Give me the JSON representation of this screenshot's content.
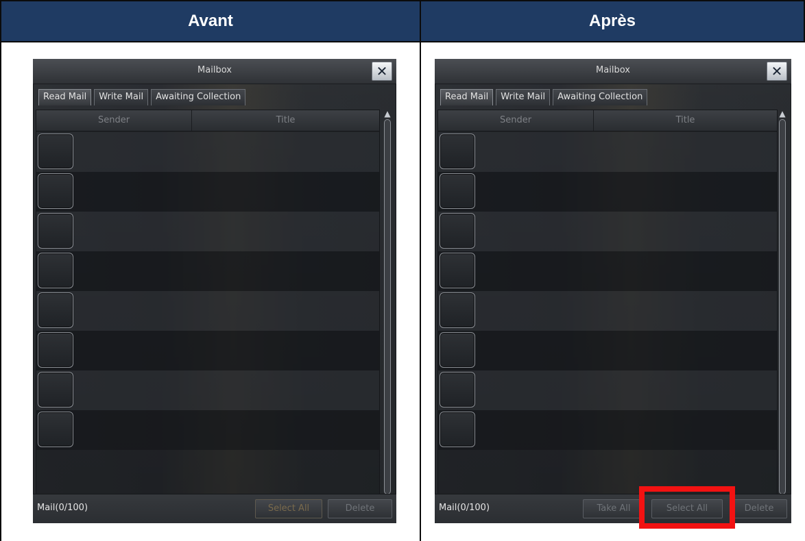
{
  "headers": {
    "before": "Avant",
    "after": "Après"
  },
  "mailbox": {
    "title": "Mailbox",
    "close_glyph": "✕",
    "tabs": [
      "Read Mail",
      "Write Mail",
      "Awaiting Collection"
    ],
    "columns": {
      "sender": "Sender",
      "title": "Title"
    },
    "mail_count": "Mail(0/100)",
    "rows_count": 8
  },
  "before_buttons": {
    "select_all": "Select All",
    "delete": "Delete"
  },
  "after_buttons": {
    "take_all": "Take All",
    "select_all": "Select All",
    "delete": "Delete"
  },
  "icons": [
    "close-icon",
    "scroll-up-icon",
    "scroll-down-icon"
  ],
  "colors": {
    "header_bg": "#1f3b63",
    "highlight": "#f31212"
  }
}
